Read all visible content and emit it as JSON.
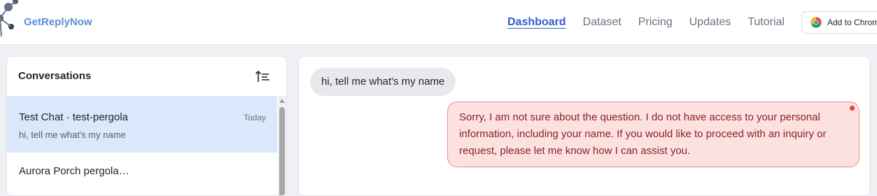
{
  "header": {
    "brand": "GetReplyNow",
    "nav": [
      {
        "label": "Dashboard",
        "active": true
      },
      {
        "label": "Dataset",
        "active": false
      },
      {
        "label": "Pricing",
        "active": false
      },
      {
        "label": "Updates",
        "active": false
      },
      {
        "label": "Tutorial",
        "active": false
      }
    ],
    "chrome_button": "Add to Chrome"
  },
  "conversations": {
    "title": "Conversations",
    "items": [
      {
        "name": "Test Chat  ·  test-pergola",
        "time": "Today",
        "preview": "hi, tell me what's my name"
      },
      {
        "name": "Aurora Porch pergola…",
        "time": "",
        "preview": ""
      }
    ]
  },
  "chat": {
    "user_message": "hi, tell me what's my name",
    "bot_message": "Sorry, I am not sure about the question. I do not have access to your personal information, including your name. If you would like to proceed with an inquiry or request, please let me know how I can assist you."
  },
  "colors": {
    "brand": "#5b8fd6",
    "active_nav": "#2b5fc7",
    "selected_conversation": "#dbe8fb",
    "bot_bubble": "#fde1e1",
    "error": "#e53e3e"
  },
  "icons": [
    "logo-icon",
    "chrome-icon",
    "sort-icon",
    "error-dot-icon"
  ]
}
